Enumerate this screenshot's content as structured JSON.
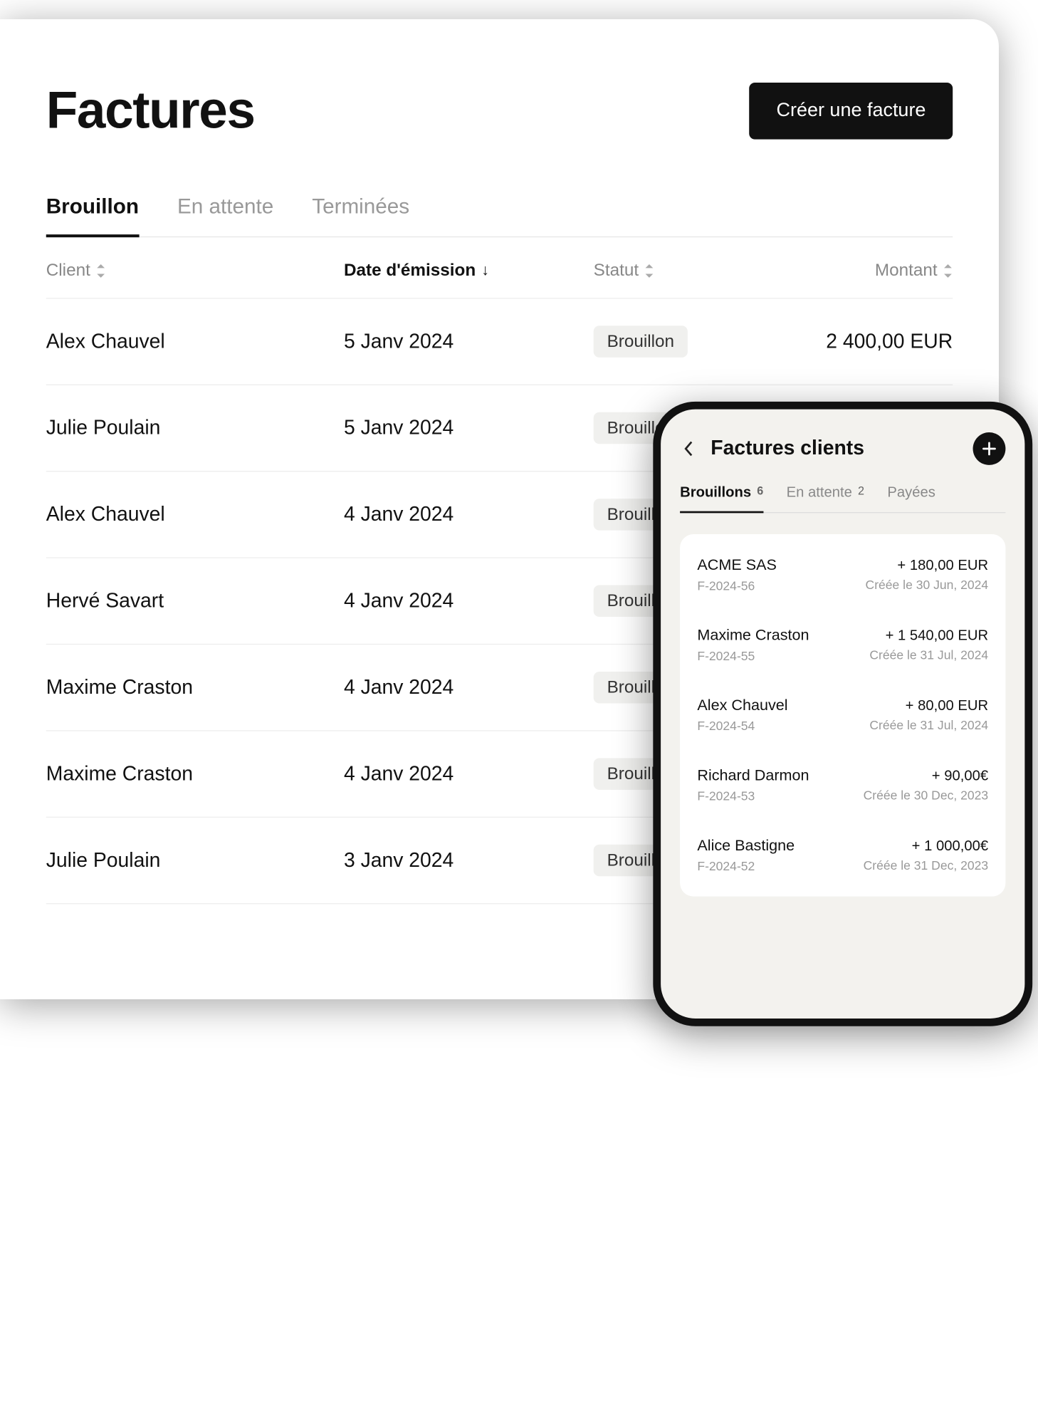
{
  "desktop": {
    "title": "Factures",
    "create_button": "Créer une facture",
    "tabs": [
      {
        "label": "Brouillon",
        "active": true
      },
      {
        "label": "En attente",
        "active": false
      },
      {
        "label": "Terminées",
        "active": false
      }
    ],
    "columns": {
      "client": "Client",
      "date": "Date d'émission",
      "status": "Statut",
      "amount": "Montant"
    },
    "rows": [
      {
        "client": "Alex Chauvel",
        "date": "5 Janv 2024",
        "status": "Brouillon",
        "amount": "2 400,00 EUR"
      },
      {
        "client": "Julie Poulain",
        "date": "5 Janv 2024",
        "status": "Brouillon",
        "amount": ""
      },
      {
        "client": "Alex Chauvel",
        "date": "4 Janv 2024",
        "status": "Brouillon",
        "amount": ""
      },
      {
        "client": "Hervé Savart",
        "date": "4 Janv 2024",
        "status": "Brouillon",
        "amount": ""
      },
      {
        "client": "Maxime Craston",
        "date": "4 Janv 2024",
        "status": "Brouillon",
        "amount": ""
      },
      {
        "client": "Maxime Craston",
        "date": "4 Janv 2024",
        "status": "Brouillon",
        "amount": ""
      },
      {
        "client": "Julie Poulain",
        "date": "3 Janv 2024",
        "status": "Brouillon",
        "amount": ""
      }
    ]
  },
  "mobile": {
    "title": "Factures clients",
    "tabs": [
      {
        "label": "Brouillons",
        "count": "6",
        "active": true
      },
      {
        "label": "En attente",
        "count": "2",
        "active": false
      },
      {
        "label": "Payées",
        "count": "",
        "active": false
      }
    ],
    "rows": [
      {
        "name": "ACME SAS",
        "ref": "F-2024-56",
        "amount": "+ 180,00 EUR",
        "date": "Créée le 30 Jun, 2024"
      },
      {
        "name": "Maxime Craston",
        "ref": "F-2024-55",
        "amount": "+ 1 540,00 EUR",
        "date": "Créée le 31 Jul, 2024"
      },
      {
        "name": "Alex Chauvel",
        "ref": "F-2024-54",
        "amount": "+ 80,00 EUR",
        "date": "Créée le 31 Jul, 2024"
      },
      {
        "name": "Richard Darmon",
        "ref": "F-2024-53",
        "amount": "+ 90,00€",
        "date": "Créée le 30 Dec, 2023"
      },
      {
        "name": "Alice Bastigne",
        "ref": "F-2024-52",
        "amount": "+ 1 000,00€",
        "date": "Créée le 31 Dec, 2023"
      }
    ]
  }
}
